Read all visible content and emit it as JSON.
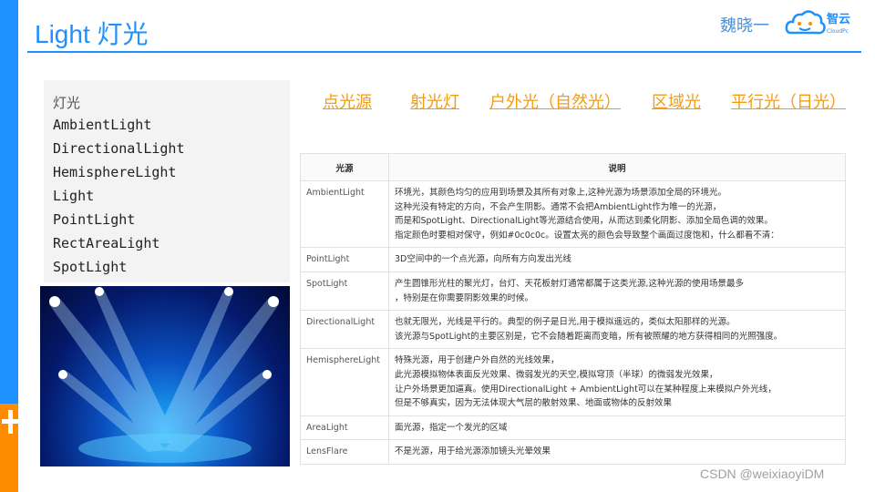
{
  "slide": {
    "title": "Light 灯光",
    "author": "魏晓一",
    "logo_text": "智云",
    "logo_subtext": "CloudPc"
  },
  "menu": {
    "heading": "灯光",
    "items": [
      "AmbientLight",
      "DirectionalLight",
      "HemisphereLight",
      "Light",
      "PointLight",
      "RectAreaLight",
      "SpotLight"
    ]
  },
  "nav_links": [
    "点光源",
    "射光灯",
    "户外光（自然光）",
    "区域光",
    "平行光（日光）"
  ],
  "table": {
    "headers": [
      "光源",
      "说明"
    ],
    "rows": [
      {
        "name": "AmbientLight",
        "lines": [
          "环境光，其颜色均匀的应用到场景及其所有对象上,这种光源为场景添加全局的环境光。",
          "这种光没有特定的方向，不会产生阴影。通常不会把AmbientLight作为唯一的光源，",
          "而是和SpotLight、DirectionalLight等光源结合使用，从而达到柔化阴影、添加全局色调的效果。",
          "指定颜色时要相对保守，例如#0c0c0c。设置太亮的颜色会导致整个画面过度饱和，什么都看不清："
        ]
      },
      {
        "name": "PointLight",
        "lines": [
          "3D空间中的一个点光源，向所有方向发出光线"
        ]
      },
      {
        "name": "SpotLight",
        "lines": [
          "产生圆锥形光柱的聚光灯，台灯、天花板射灯通常都属于这类光源,这种光源的使用场景最多",
          "，特别是在你需要阴影效果的时候。"
        ]
      },
      {
        "name": "DirectionalLight",
        "lines": [
          "也就无限光，光线是平行的。典型的例子是日光,用于模拟遥远的，类似太阳那样的光源。",
          "该光源与SpotLight的主要区别是，它不会随着距离而变暗，所有被照耀的地方获得相同的光照强度。"
        ]
      },
      {
        "name": "HemisphereLight",
        "lines": [
          "特殊光源，用于创建户外自然的光线效果，",
          "此光源模拟物体表面反光效果、微弱发光的天空,模拟穹顶（半球）的微弱发光效果，",
          "让户外场景更加逼真。使用DirectionalLight + AmbientLight可以在某种程度上来模拟户外光线，",
          "但是不够真实，因为无法体现大气层的散射效果、地面或物体的反射效果"
        ]
      },
      {
        "name": "AreaLight",
        "lines": [
          "面光源，指定一个发光的区域"
        ]
      },
      {
        "name": "LensFlare",
        "lines": [
          "不是光源，用于给光源添加镜头光晕效果"
        ]
      }
    ]
  },
  "watermark": "CSDN @weixiaoyiDM",
  "colors": {
    "accent": "#1e90ff",
    "orange": "#ff8c00",
    "link": "#f39c12"
  }
}
